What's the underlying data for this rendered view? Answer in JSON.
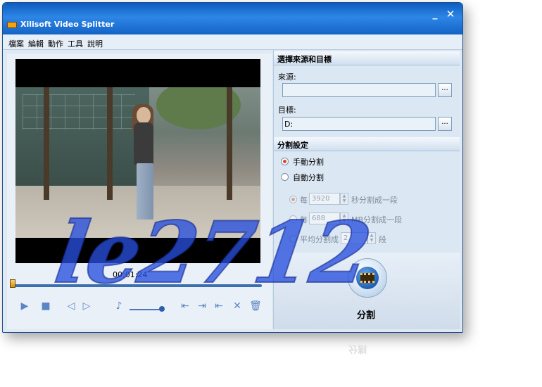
{
  "window": {
    "title": "Xilisoft Video Splitter",
    "minimize": "_",
    "close": "✕"
  },
  "menu": [
    "檔案",
    "編輯",
    "動作",
    "工具",
    "說明"
  ],
  "player": {
    "timecode": "00:01:24",
    "controls": [
      "play",
      "stop",
      "prev-frame",
      "next-frame",
      "volume",
      "set-start",
      "set-end",
      "delete",
      "trash"
    ]
  },
  "source_target": {
    "header": "選擇來源和目標",
    "source_label": "來源:",
    "source_value": "",
    "browse": "...",
    "target_label": "目標:",
    "target_value": "D:"
  },
  "split_settings": {
    "header": "分割設定",
    "manual_label": "手動分割",
    "auto_label": "自動分割",
    "mode_selected": "manual",
    "by_seconds_prefix": "每",
    "by_seconds_value": "3920",
    "by_seconds_suffix": "秒分割成一段",
    "by_mb_prefix": "每",
    "by_mb_value": "688",
    "by_mb_suffix": "MB分割成一段",
    "avg_prefix": "平均分割成",
    "avg_value": "2",
    "avg_suffix": "段"
  },
  "split_button": {
    "label": "分割"
  },
  "watermark": "le2712",
  "reflection": "分割",
  "colors": {
    "titlebar": "#1463c6",
    "watermark": "#2850dc",
    "accent": "#d8492a"
  }
}
